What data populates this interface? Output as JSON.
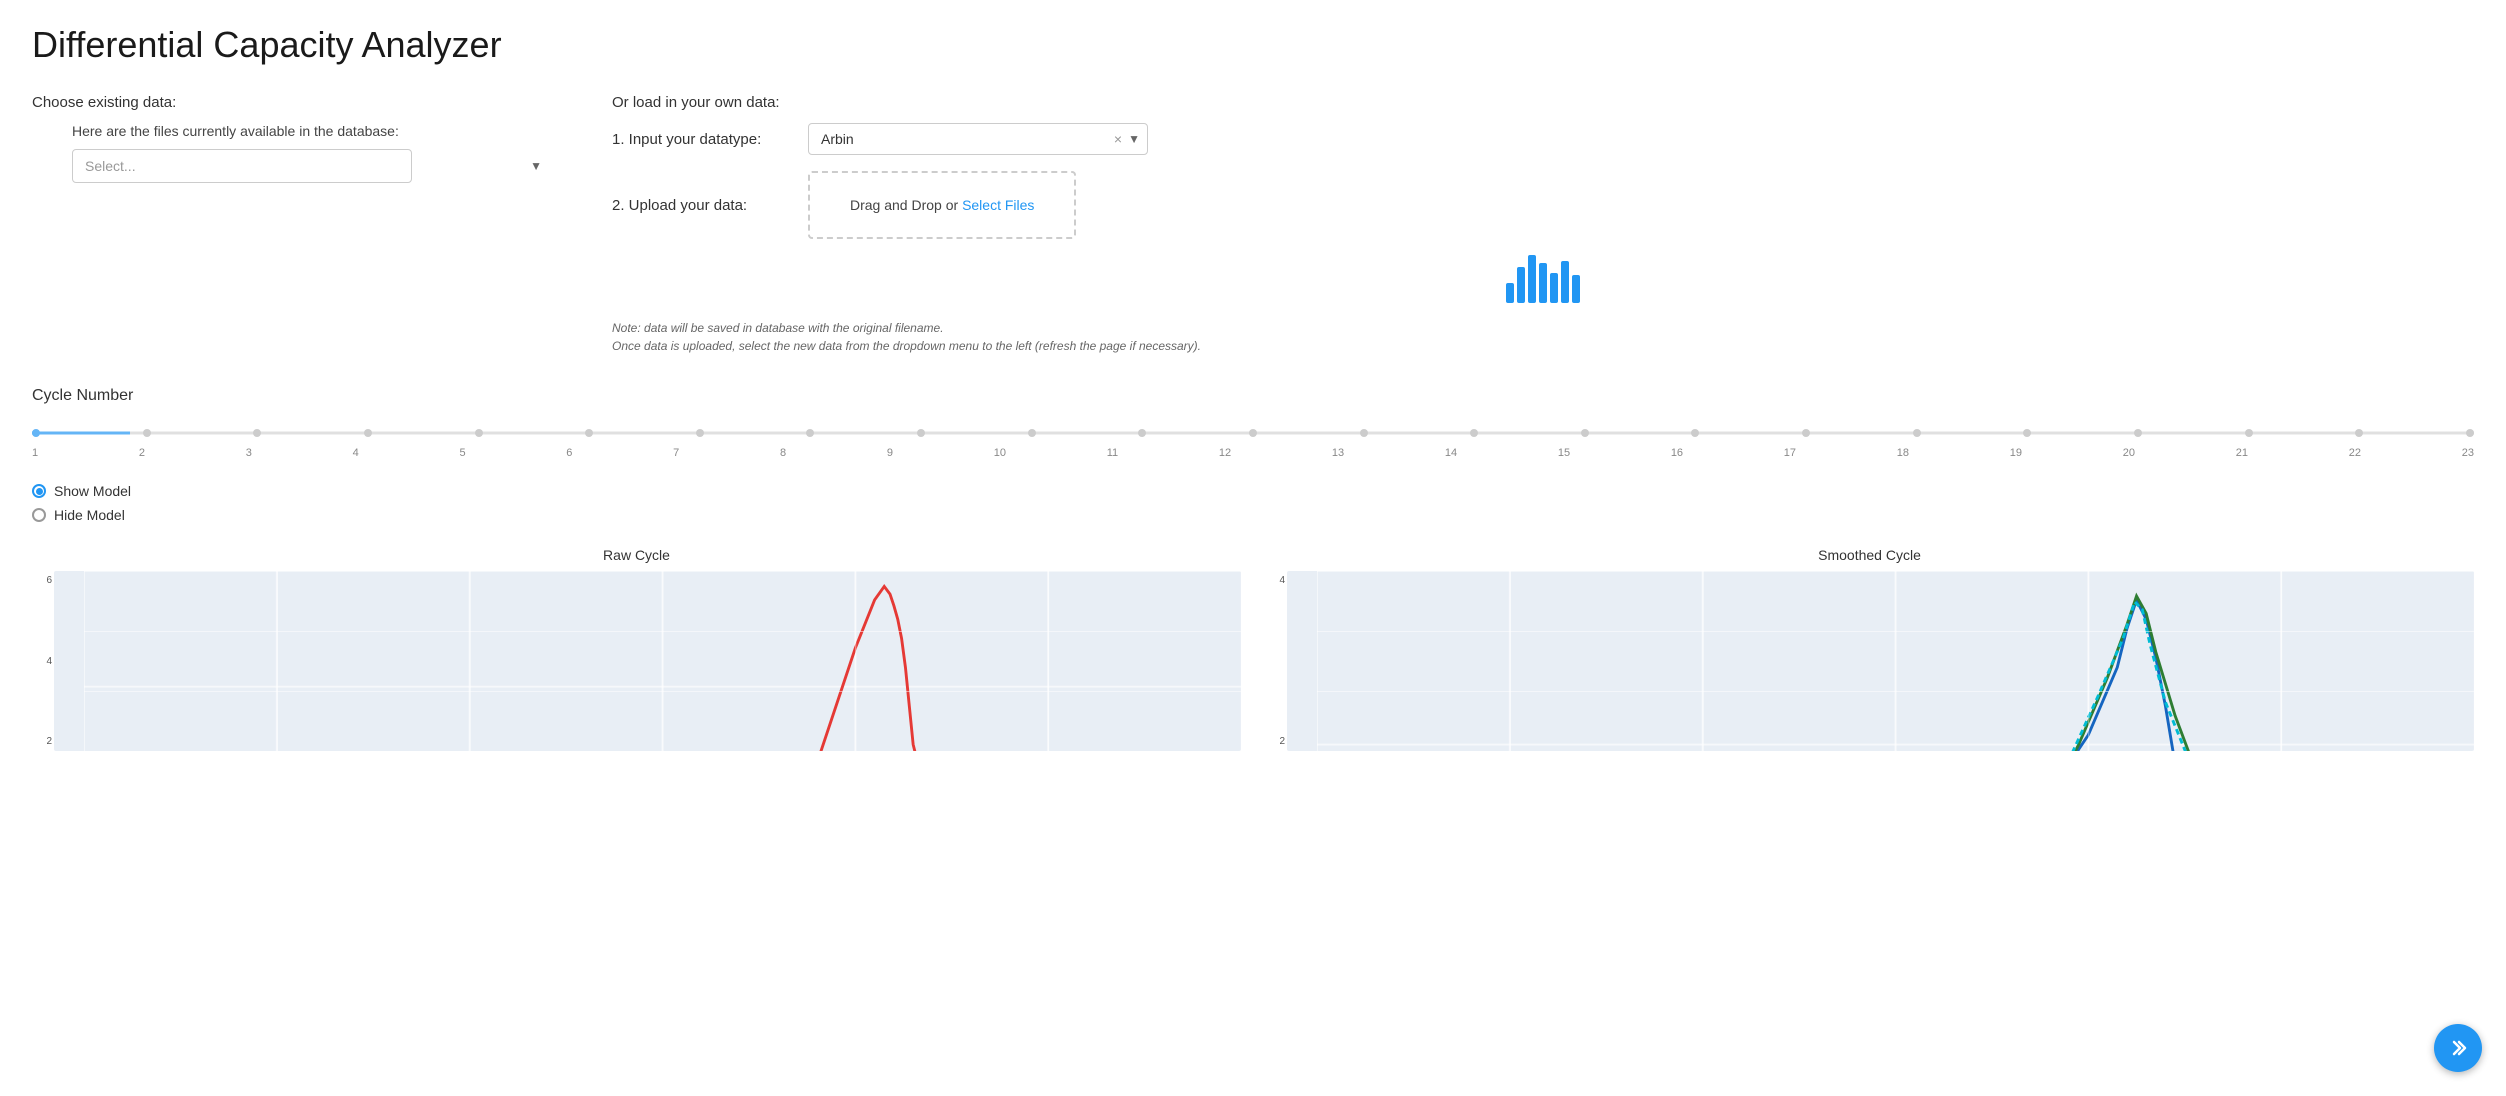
{
  "page": {
    "title": "Differential Capacity Analyzer"
  },
  "left_panel": {
    "section_label": "Choose existing data:",
    "sub_label": "Here are the files currently available in the database:",
    "select_placeholder": "Select..."
  },
  "right_panel": {
    "section_label": "Or load in your own data:",
    "step1_label": "1. Input your datatype:",
    "datatype_value": "Arbin",
    "step2_label": "2. Upload your data:",
    "upload_text": "Drag and Drop or ",
    "upload_link_text": "Select Files",
    "note_line1": "Note: data will be saved in database with the original filename.",
    "note_line2": "Once data is uploaded, select the new data from the dropdown menu to the left (refresh the page if necessary)."
  },
  "cycle": {
    "title": "Cycle Number",
    "slider_value": 1,
    "ticks": [
      1,
      2,
      3,
      4,
      5,
      6,
      7,
      8,
      9,
      10,
      11,
      12,
      13,
      14,
      15,
      16,
      17,
      18,
      19,
      20,
      21,
      22,
      23
    ]
  },
  "model_options": {
    "show_label": "Show Model",
    "hide_label": "Hide Model",
    "selected": "show"
  },
  "charts": {
    "raw_title": "Raw Cycle",
    "smoothed_title": "Smoothed Cycle",
    "raw_y_labels": [
      "6",
      "",
      "4",
      "",
      "2"
    ],
    "smoothed_y_labels": [
      "4",
      "",
      "",
      "2"
    ]
  },
  "nav_button": {
    "icon": "❯"
  }
}
